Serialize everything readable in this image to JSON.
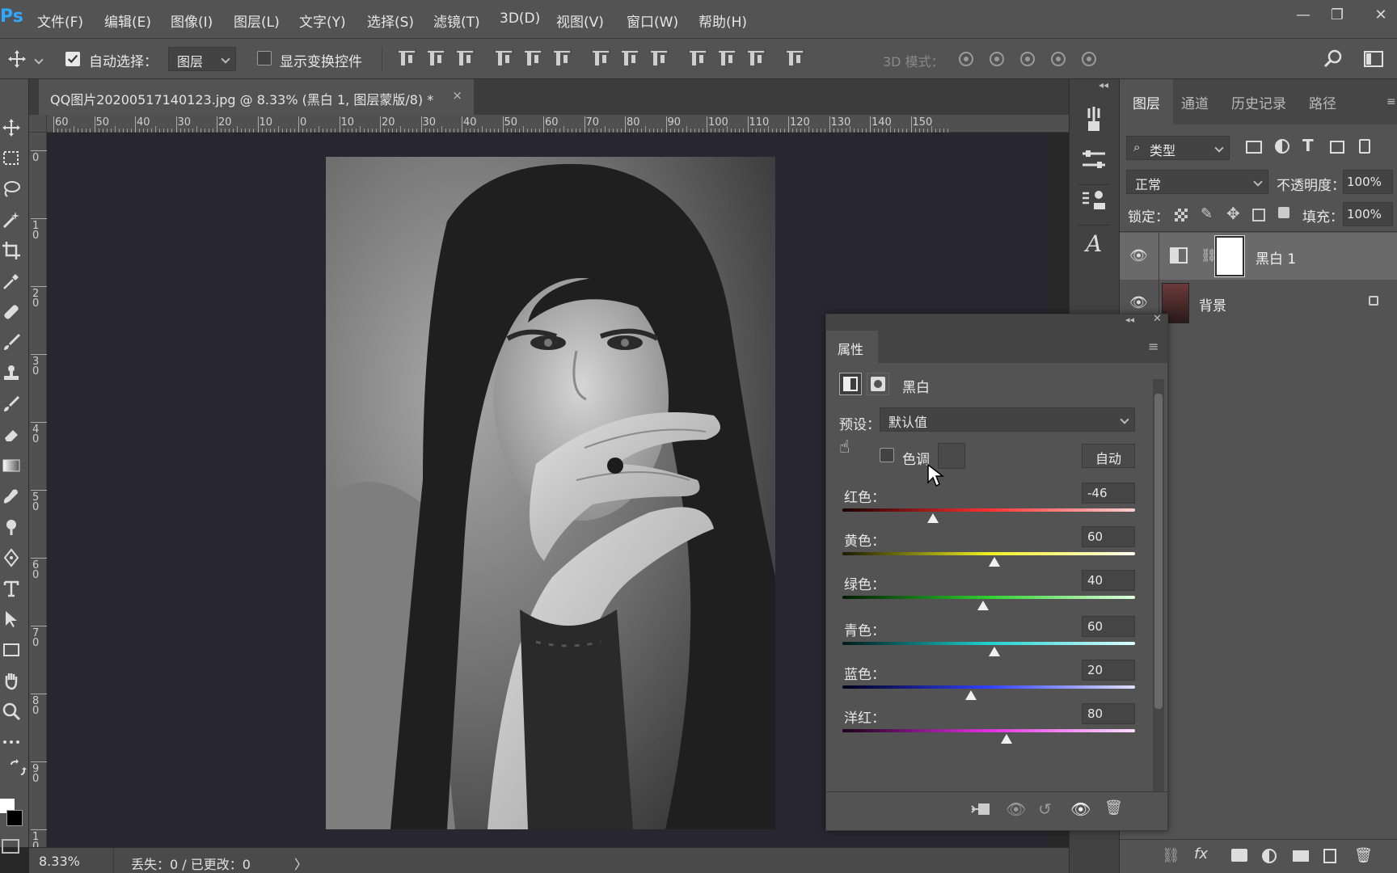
{
  "app": {
    "logo": "Ps"
  },
  "menu": [
    "文件(F)",
    "编辑(E)",
    "图像(I)",
    "图层(L)",
    "文字(Y)",
    "选择(S)",
    "滤镜(T)",
    "3D(D)",
    "视图(V)",
    "窗口(W)",
    "帮助(H)"
  ],
  "window_controls": {
    "minimize": "—",
    "restore": "❐",
    "close": "✕"
  },
  "options": {
    "auto_select_label": "自动选择：",
    "auto_select_checked": true,
    "auto_select_target": "图层",
    "show_transform_label": "显示变换控件",
    "show_transform_checked": false,
    "mode_3d_label": "3D 模式："
  },
  "document": {
    "tab_title": "QQ图片20200517140123.jpg @ 8.33% (黑白 1, 图层蒙版/8) *",
    "close": "×",
    "ruler_h": [
      "60",
      "50",
      "40",
      "30",
      "20",
      "10",
      "0",
      "10",
      "20",
      "30",
      "40",
      "50",
      "60",
      "70",
      "80",
      "90",
      "100",
      "110",
      "120",
      "130",
      "140",
      "150"
    ],
    "ruler_v": [
      "0",
      "1\n0",
      "2\n0",
      "3\n0",
      "4\n0",
      "5\n0",
      "6\n0",
      "7\n0",
      "8\n0",
      "9\n0",
      "1\n0"
    ]
  },
  "status": {
    "zoom": "8.33%",
    "info": "丢失：0 / 已更改：0",
    "arrow": "〉"
  },
  "layers_panel": {
    "tabs": [
      "图层",
      "通道",
      "历史记录",
      "路径"
    ],
    "filter_label": "类型",
    "blend_mode": "正常",
    "opacity_label": "不透明度：",
    "opacity_value": "100%",
    "lock_label": "锁定：",
    "fill_label": "填充：",
    "fill_value": "100%",
    "layers": [
      {
        "name": "黑白 1",
        "selected": true
      },
      {
        "name": "背景",
        "selected": false,
        "locked": true
      }
    ]
  },
  "properties": {
    "tab": "属性",
    "type_label": "黑白",
    "preset_label": "预设：",
    "preset_value": "默认值",
    "tint_label": "色调",
    "tint_checked": false,
    "auto_button": "自动",
    "sliders": [
      {
        "label": "红色：",
        "value": "-46",
        "pos": 0.31,
        "gradient": "linear-gradient(90deg,#1a0000,#ff3030,#ffd0d0)"
      },
      {
        "label": "黄色：",
        "value": "60",
        "pos": 0.52,
        "gradient": "linear-gradient(90deg,#1a1a00,#f0f020,#fffff0)"
      },
      {
        "label": "绿色：",
        "value": "40",
        "pos": 0.48,
        "gradient": "linear-gradient(90deg,#001a00,#30d030,#e0ffe0)"
      },
      {
        "label": "青色：",
        "value": "60",
        "pos": 0.52,
        "gradient": "linear-gradient(90deg,#001a1a,#20d0d0,#e0ffff)"
      },
      {
        "label": "蓝色：",
        "value": "20",
        "pos": 0.44,
        "gradient": "linear-gradient(90deg,#00001a,#3040ff,#e0e0ff)"
      },
      {
        "label": "洋红：",
        "value": "80",
        "pos": 0.56,
        "gradient": "linear-gradient(90deg,#1a001a,#e030e0,#ffe0ff)"
      }
    ]
  },
  "colors": {
    "panel": "#535353",
    "canvas": "#282630",
    "accent": "#31a8ff"
  }
}
